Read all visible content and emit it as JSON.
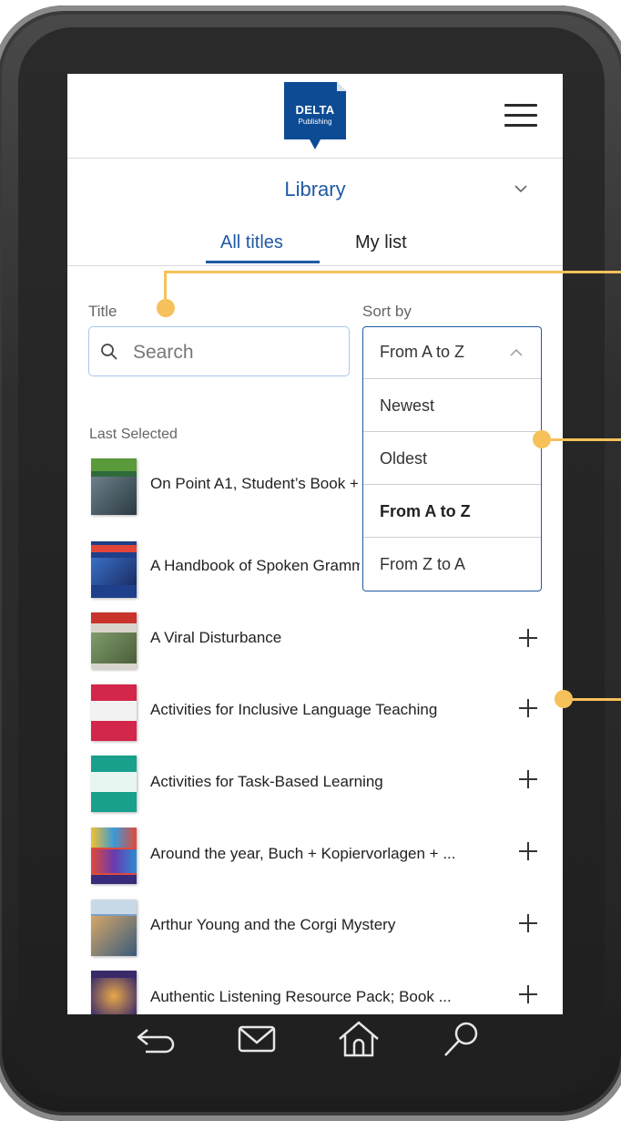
{
  "header": {
    "logo_line1": "DELTA",
    "logo_line2": "Publishing",
    "menu_icon": "hamburger-icon",
    "brand_color": "#0d4b94"
  },
  "library": {
    "title": "Library",
    "chevron_icon": "chevron-down-icon",
    "tabs": [
      {
        "label": "All titles",
        "active": true
      },
      {
        "label": "My list",
        "active": false
      }
    ],
    "accent_color": "#1f5aa6"
  },
  "filters": {
    "title_label": "Title",
    "search_placeholder": "Search",
    "sort_label": "Sort by",
    "sort_value": "From A to Z",
    "sort_options": [
      {
        "label": "Newest",
        "selected": false
      },
      {
        "label": "Oldest",
        "selected": false
      },
      {
        "label": "From A to Z",
        "selected": true
      },
      {
        "label": "From Z to A",
        "selected": false
      }
    ]
  },
  "list": {
    "section_label": "Last Selected",
    "books": [
      {
        "title": "On Point A1, Student’s Book + ...",
        "cover_color": "#2f6a3a",
        "cover_icon": "book-cover-image"
      },
      {
        "title": "A Handbook of Spoken Grammar",
        "cover_color": "#1e3f8a",
        "cover_icon": "book-cover-image"
      },
      {
        "title": "A Viral Disturbance",
        "cover_color": "#d9d5cc",
        "cover_icon": "book-cover-image"
      },
      {
        "title": "Activities for Inclusive Language Teaching",
        "cover_color": "#d2264a",
        "cover_icon": "book-cover-image"
      },
      {
        "title": "Activities for Task-Based Learning",
        "cover_color": "#19a08c",
        "cover_icon": "book-cover-image"
      },
      {
        "title": "Around the year, Buch + Kopiervorlagen + ...",
        "cover_color": "#e04a3a",
        "cover_icon": "book-cover-image"
      },
      {
        "title": "Arthur Young and the Corgi Mystery",
        "cover_color": "#7aa0c4",
        "cover_icon": "book-cover-image"
      },
      {
        "title": "Authentic Listening Resource Pack; Book ...",
        "cover_color": "#3a2a6a",
        "cover_icon": "book-cover-image"
      }
    ]
  },
  "callout_color": "#f6c15a",
  "navbar": [
    "back-icon",
    "mail-icon",
    "home-icon",
    "search-icon"
  ]
}
